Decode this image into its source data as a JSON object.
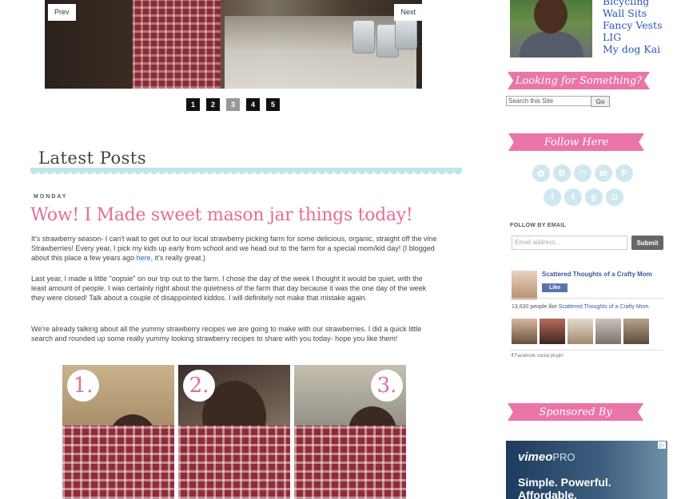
{
  "slider": {
    "prev_label": "Prev",
    "next_label": "Next",
    "pages": [
      "1",
      "2",
      "3",
      "4",
      "5"
    ],
    "active_page": "3"
  },
  "main": {
    "section_title": "Latest Posts",
    "post": {
      "day": "MONDAY",
      "title": "Wow! I Made sweet mason jar things today!",
      "p1_before_link": "It's strawberry season- I can't wait to get out to our local strawberry picking farm for some delicious, organic, straight off the vine Strawberries!  Every year, I pick my kids up early from school and we head out to the farm for a special mom/kid day!  (I blogged about this place a few years ago ",
      "p1_link": "here",
      "p1_after_link": ", it's really great.)",
      "p2": "Last year, I made a little \"oopsie\" on our trip out to the farm.  I chose the day of the week I thought it would be quiet, with the least amount of people.  I was certainly right about the quietness of the farm that day because it was the one day of the week they were closed!  Talk about a couple of disappointed kiddos.  I will definitely not make that mistake again.",
      "p3": "We're already talking about all the yummy strawberry recipes we are going to make with our strawberries.  I did a quick little search and rounded up some really yummy looking strawberry recipes to share with you today-  hope you like them!",
      "photo_numbers": [
        "1.",
        "2.",
        "3."
      ]
    }
  },
  "sidebar": {
    "links": [
      "Bicycling",
      "Wall Sits",
      "Fancy Vests",
      "LIG",
      "My dog Kai"
    ],
    "search_heading": "Looking for Something?",
    "search_value": "Search this Site",
    "search_button": "Go",
    "follow_heading": "Follow Here",
    "social_icons": [
      "flickr-icon",
      "blogger-icon",
      "rss-icon",
      "email-icon",
      "pinterest-icon",
      "facebook-icon",
      "twitter-icon",
      "googleplus-icon",
      "instagram-icon"
    ],
    "follow_email_label": "FOLLOW BY EMAIL",
    "email_placeholder": "Email address...",
    "submit_label": "Submit",
    "facebook": {
      "page_name": "Scattered Thoughts of a Crafty Mom",
      "like_label": "Like",
      "count_prefix": "13,630 people like ",
      "count_page": "Scattered Thoughts of a Crafty Mom.",
      "plugin_label": "Facebook social plugin"
    },
    "sponsored_heading": "Sponsored By",
    "ad": {
      "brand": "vimeo",
      "brand_suffix": "PRO",
      "tagline_1": "Simple. Powerful.",
      "tagline_2": "Affordable."
    }
  },
  "colors": {
    "accent_pink": "#e976a6",
    "title_pink": "#e56c98",
    "link_blue": "#2b56b8",
    "scallop": "#bfe6ea"
  }
}
